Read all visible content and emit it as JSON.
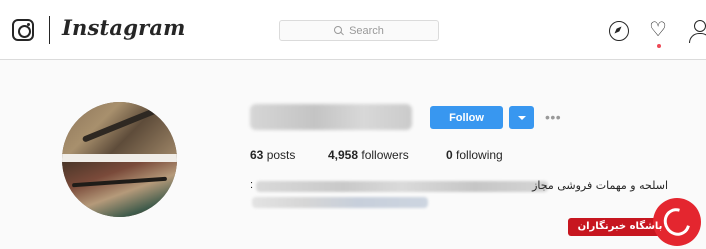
{
  "header": {
    "wordmark": "Instagram",
    "search_placeholder": "Search"
  },
  "profile": {
    "follow_label": "Follow",
    "more_options_glyph": "•••",
    "stats": {
      "posts": {
        "count": "63",
        "label": "posts"
      },
      "followers": {
        "count": "4,958",
        "label": "followers"
      },
      "following": {
        "count": "0",
        "label": "following"
      }
    },
    "bio_prefix": ":",
    "bio_text": "اسلحه و مهمات فروشی مجاز"
  },
  "watermark": {
    "text": "باشگاه خبرنگاران"
  },
  "colors": {
    "accent_blue": "#3897f0",
    "notification_red": "#ed4956",
    "watermark_red": "#e4262f"
  },
  "icons": [
    "instagram-glyph-icon",
    "search-icon",
    "explore-compass-icon",
    "heart-icon",
    "profile-icon",
    "chevron-down-icon",
    "more-options-icon"
  ]
}
